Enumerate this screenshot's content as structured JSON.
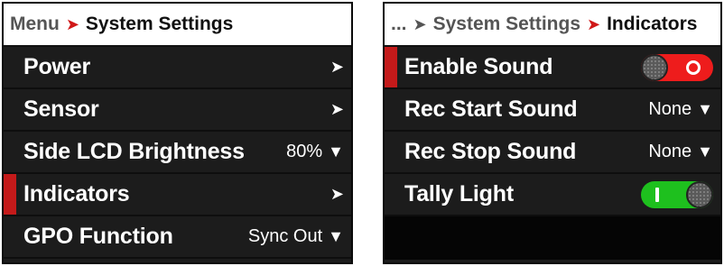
{
  "left_panel": {
    "breadcrumb": {
      "root": "Menu",
      "current": "System Settings"
    },
    "items": [
      {
        "label": "Power",
        "value": ""
      },
      {
        "label": "Sensor",
        "value": ""
      },
      {
        "label": "Side LCD Brightness",
        "value": "80%"
      },
      {
        "label": "Indicators",
        "value": "",
        "selected": true
      },
      {
        "label": "GPO Function",
        "value": "Sync Out"
      }
    ]
  },
  "right_panel": {
    "breadcrumb": {
      "root": "...",
      "parent": "System Settings",
      "current": "Indicators"
    },
    "items": [
      {
        "label": "Enable Sound",
        "toggle": "off",
        "selected": true
      },
      {
        "label": "Rec Start Sound",
        "value": "None"
      },
      {
        "label": "Rec Stop Sound",
        "value": "None"
      },
      {
        "label": "Tally Light",
        "toggle": "on"
      }
    ]
  },
  "icons": {
    "breadcrumb_separator": "arrow-right-icon",
    "submenu": "chevron-right-icon",
    "dropdown": "chevron-down-icon"
  },
  "colors": {
    "accent_red": "#c41a1a",
    "toggle_off": "#ee1c1c",
    "toggle_on": "#1ec01e",
    "background": "#1c1c1c"
  }
}
